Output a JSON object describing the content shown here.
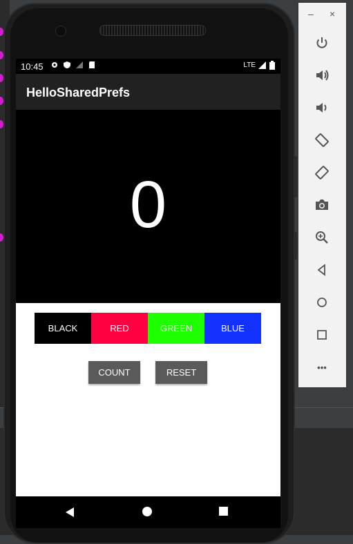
{
  "status_bar": {
    "time": "10:45",
    "network": "LTE"
  },
  "app_bar": {
    "title": "HelloSharedPrefs"
  },
  "counter": {
    "value": "0"
  },
  "color_buttons": [
    {
      "label": "BLACK",
      "color": "#000000"
    },
    {
      "label": "RED",
      "color": "#ff0040"
    },
    {
      "label": "GREEN",
      "color": "#1eff00"
    },
    {
      "label": "BLUE",
      "color": "#1432ff"
    }
  ],
  "actions": {
    "count_label": "COUNT",
    "reset_label": "RESET"
  },
  "emulator_toolbar": {
    "minimize": "–",
    "close": "×",
    "buttons": [
      "power-icon",
      "volume-up-icon",
      "volume-down-icon",
      "rotate-left-icon",
      "rotate-right-icon",
      "camera-icon",
      "zoom-icon",
      "back-icon",
      "home-icon",
      "overview-icon",
      "more-icon"
    ],
    "more": "•••"
  }
}
